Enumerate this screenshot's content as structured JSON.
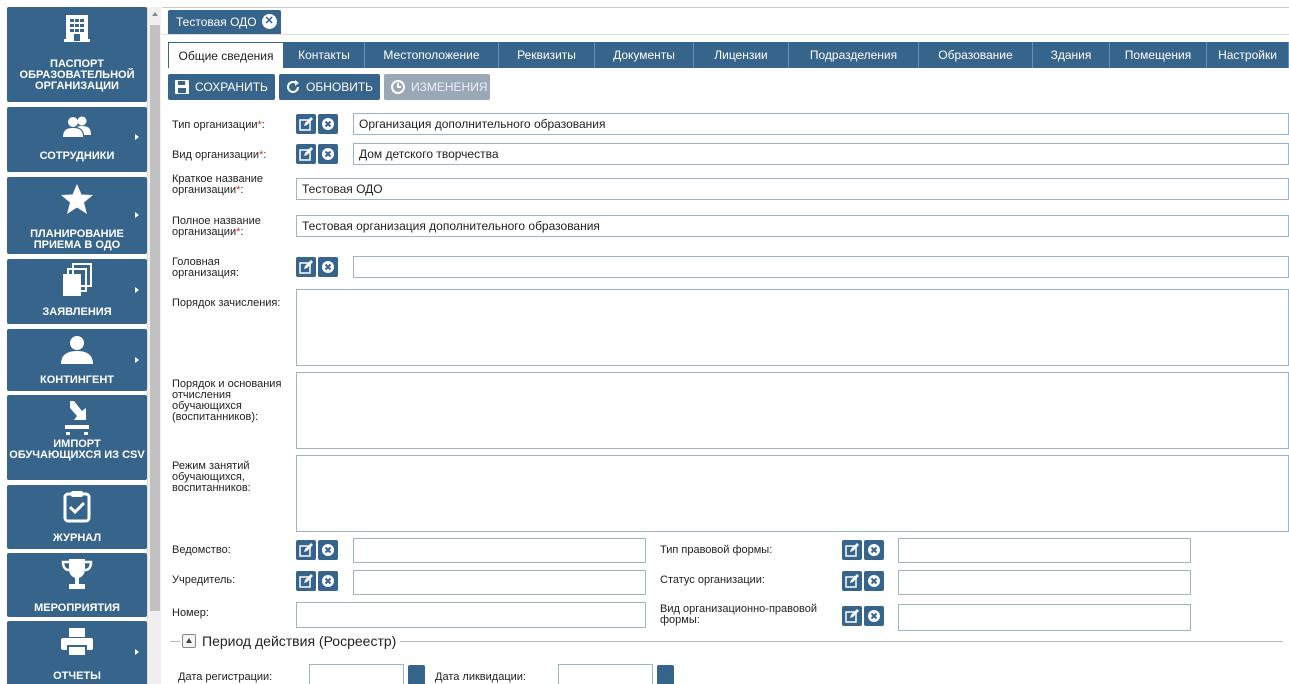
{
  "sidebar": {
    "items": [
      {
        "label": "Паспорт образовательной организации",
        "icon": "building-icon"
      },
      {
        "label": "Сотрудники",
        "icon": "users-icon"
      },
      {
        "label": "Планирование приема в ОДО",
        "icon": "star-icon"
      },
      {
        "label": "Заявления",
        "icon": "documents-icon"
      },
      {
        "label": "Контингент",
        "icon": "person-icon"
      },
      {
        "label": "Импорт обучающихся из CSV",
        "icon": "import-icon"
      },
      {
        "label": "Журнал",
        "icon": "journal-icon"
      },
      {
        "label": "Мероприятия",
        "icon": "trophy-icon"
      },
      {
        "label": "Отчеты",
        "icon": "printer-icon"
      }
    ]
  },
  "doc_tab": {
    "label": "Тестовая ОДО"
  },
  "tabs": [
    {
      "label": "Общие сведения"
    },
    {
      "label": "Контакты"
    },
    {
      "label": "Местоположение"
    },
    {
      "label": "Реквизиты"
    },
    {
      "label": "Документы"
    },
    {
      "label": "Лицензии"
    },
    {
      "label": "Подразделения"
    },
    {
      "label": "Образование"
    },
    {
      "label": "Здания"
    },
    {
      "label": "Помещения"
    },
    {
      "label": "Настройки"
    }
  ],
  "toolbar": {
    "save_label": "СОХРАНИТЬ",
    "refresh_label": "ОБНОВИТЬ",
    "changes_label": "ИЗМЕНЕНИЯ"
  },
  "form": {
    "org_type": {
      "label": "Тип организации",
      "value": "Организация дополнительного образования"
    },
    "org_kind": {
      "label": "Вид организации",
      "value": "Дом детского творчества"
    },
    "short_name": {
      "label1": "Краткое название",
      "label2": "организации",
      "value": "Тестовая ОДО"
    },
    "full_name": {
      "label1": "Полное название",
      "label2": "организации",
      "value": "Тестовая организация дополнительного образования"
    },
    "head_org": {
      "label1": "Головная",
      "label2": "организация:",
      "value": ""
    },
    "enroll_order": {
      "label": "Порядок зачисления:"
    },
    "expel_order": {
      "label1": "Порядок и основания",
      "label2": "отчисления",
      "label3": "обучающихся",
      "label4": "(воспитанников):"
    },
    "schedule": {
      "label1": "Режим занятий",
      "label2": "обучающихся,",
      "label3": "воспитанников:"
    },
    "department": {
      "label": "Ведомство:",
      "value": ""
    },
    "founder": {
      "label": "Учредитель:",
      "value": ""
    },
    "number": {
      "label": "Номер:",
      "value": ""
    },
    "legal_form_type": {
      "label": "Тип правовой формы:",
      "value": ""
    },
    "org_status": {
      "label": "Статус организации:",
      "value": ""
    },
    "opf": {
      "label1": "Вид организационно-правовой",
      "label2": "формы:",
      "value": ""
    }
  },
  "period": {
    "legend": "Период действия (Росреестр)",
    "reg_date_label": "Дата регистрации:",
    "reg_date_value": "",
    "liq_date_label": "Дата ликвидации:",
    "liq_date_value": ""
  },
  "colors": {
    "accent": "#36648b",
    "disabled": "#9aa8b5",
    "required": "#c0392b"
  }
}
